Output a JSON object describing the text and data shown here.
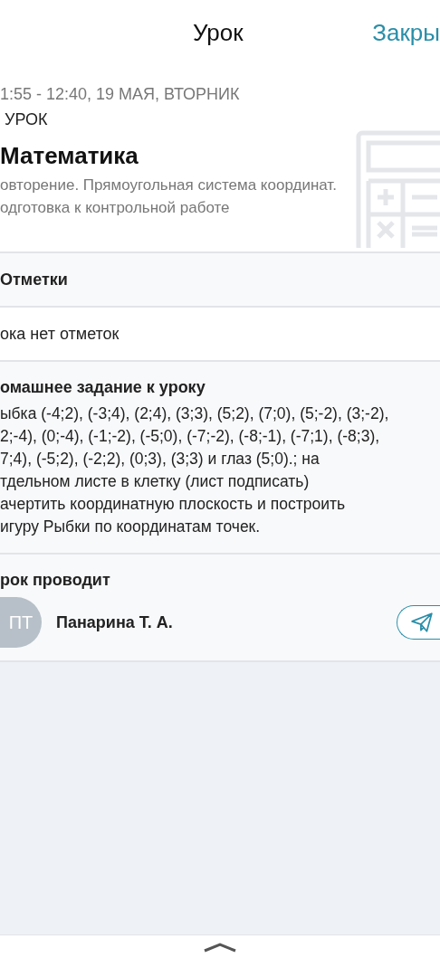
{
  "header": {
    "title": "Урок",
    "close": "Закры"
  },
  "lesson": {
    "time": "1:55 - 12:40, 19 МАЯ, ВТОРНИК",
    "type": "УРОК",
    "subject": "Математика",
    "topic": [
      "овторение. Прямоугольная система координат.",
      "одготовка к контрольной работе"
    ]
  },
  "marks": {
    "title": "Отметки",
    "empty": "ока нет отметок"
  },
  "homework": {
    "title": "омашнее задание к уроку",
    "lines": [
      "ыбка (-4;2), (-3;4), (2;4), (3;3), (5;2), (7;0), (5;-2), (3;-2),",
      "2;-4), (0;-4), (-1;-2), (-5;0), (-7;-2), (-8;-1), (-7;1), (-8;3),",
      "7;4), (-5;2), (-2;2), (0;3), (3;3) и глаз (5;0).; на",
      "тдельном листе в клетку (лист подписать)",
      "ачертить координатную плоскость и построить",
      "игуру Рыбки по координатам точек."
    ]
  },
  "teacher": {
    "title": "рок проводит",
    "initials": "ПТ",
    "name": "Панарина Т. А."
  }
}
